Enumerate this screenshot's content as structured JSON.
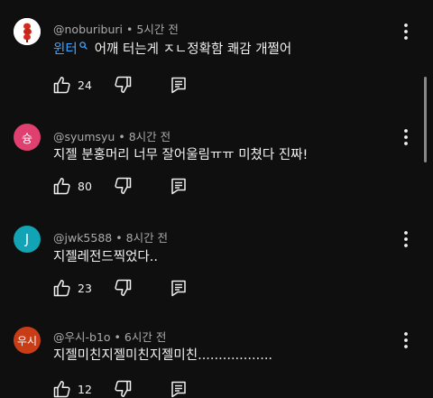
{
  "colors": {
    "background": "#0f0f0f",
    "mention": "#3ea6ff",
    "meta": "#aaaaaa"
  },
  "comments": [
    {
      "avatar": {
        "text": "",
        "color": "#ffffff",
        "icon": "profile-image-icon"
      },
      "username": "@noburiburi",
      "time": "5시간 전",
      "mention": "윈터",
      "text": "어깨 터는게 ㅈㄴ정확함 쾌감 개쩔어",
      "likes": "24"
    },
    {
      "avatar": {
        "text": "슝",
        "color": "#e04070"
      },
      "username": "@syumsyu",
      "time": "8시간 전",
      "text": "지젤 분홍머리 너무 잘어울림ㅠㅠ 미쳤다 진짜!",
      "likes": "80"
    },
    {
      "avatar": {
        "text": "J",
        "color": "#12a3b4"
      },
      "username": "@jwk5588",
      "time": "8시간 전",
      "text": "지젤레전드찍었다..",
      "likes": "23"
    },
    {
      "avatar": {
        "text": "우시",
        "color": "#c83c16"
      },
      "username": "@우시-b1o",
      "time": "6시간 전",
      "text": "지젤미친지젤미친지젤미친..................",
      "likes": "12"
    }
  ]
}
